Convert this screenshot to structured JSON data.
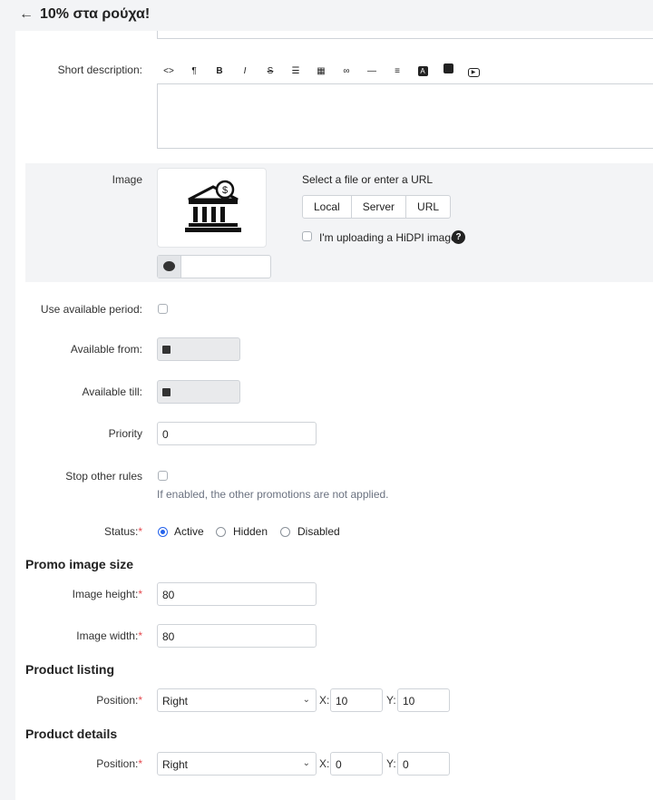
{
  "header": {
    "back_icon": "arrow-left-icon",
    "title": "10% στα ρούχα!"
  },
  "short_description": {
    "label": "Short description:",
    "toolbar": [
      "code-icon",
      "paragraph-icon",
      "bold-icon",
      "italic-icon",
      "strikethrough-icon",
      "list-icon",
      "table-icon",
      "link-icon",
      "hr-icon",
      "align-icon",
      "text-color-icon",
      "image-icon",
      "video-icon"
    ],
    "toolbar_glyphs": [
      "<>",
      "¶",
      "B",
      "I",
      "S",
      "☰",
      "▦",
      "∞",
      "—",
      "≡",
      "A",
      "▣",
      "▶"
    ]
  },
  "image": {
    "label": "Image",
    "select_text": "Select a file or enter a URL",
    "buttons": [
      "Local",
      "Server",
      "URL"
    ],
    "hidpi_label": "I'm uploading a HiDPI image.",
    "alt_value": ""
  },
  "use_available_period": {
    "label": "Use available period:"
  },
  "available_from": {
    "label": "Available from:"
  },
  "available_till": {
    "label": "Available till:"
  },
  "priority": {
    "label": "Priority",
    "value": "0"
  },
  "stop_other_rules": {
    "label": "Stop other rules",
    "hint": "If enabled, the other promotions are not applied."
  },
  "status": {
    "label": "Status:",
    "options": [
      "Active",
      "Hidden",
      "Disabled"
    ],
    "selected": "Active"
  },
  "promo_image_size": {
    "heading": "Promo image size",
    "height_label": "Image height:",
    "height_value": "80",
    "width_label": "Image width:",
    "width_value": "80"
  },
  "product_listing": {
    "heading": "Product listing",
    "position_label": "Position:",
    "position_value": "Right",
    "x_label": "X:",
    "x_value": "10",
    "y_label": "Y:",
    "y_value": "10"
  },
  "product_details": {
    "heading": "Product details",
    "position_label": "Position:",
    "position_value": "Right",
    "x_label": "X:",
    "x_value": "0",
    "y_label": "Y:",
    "y_value": "0"
  },
  "colors": {
    "accent": "#2563eb",
    "required": "#e5484d",
    "panel_bg": "#f3f4f6"
  }
}
